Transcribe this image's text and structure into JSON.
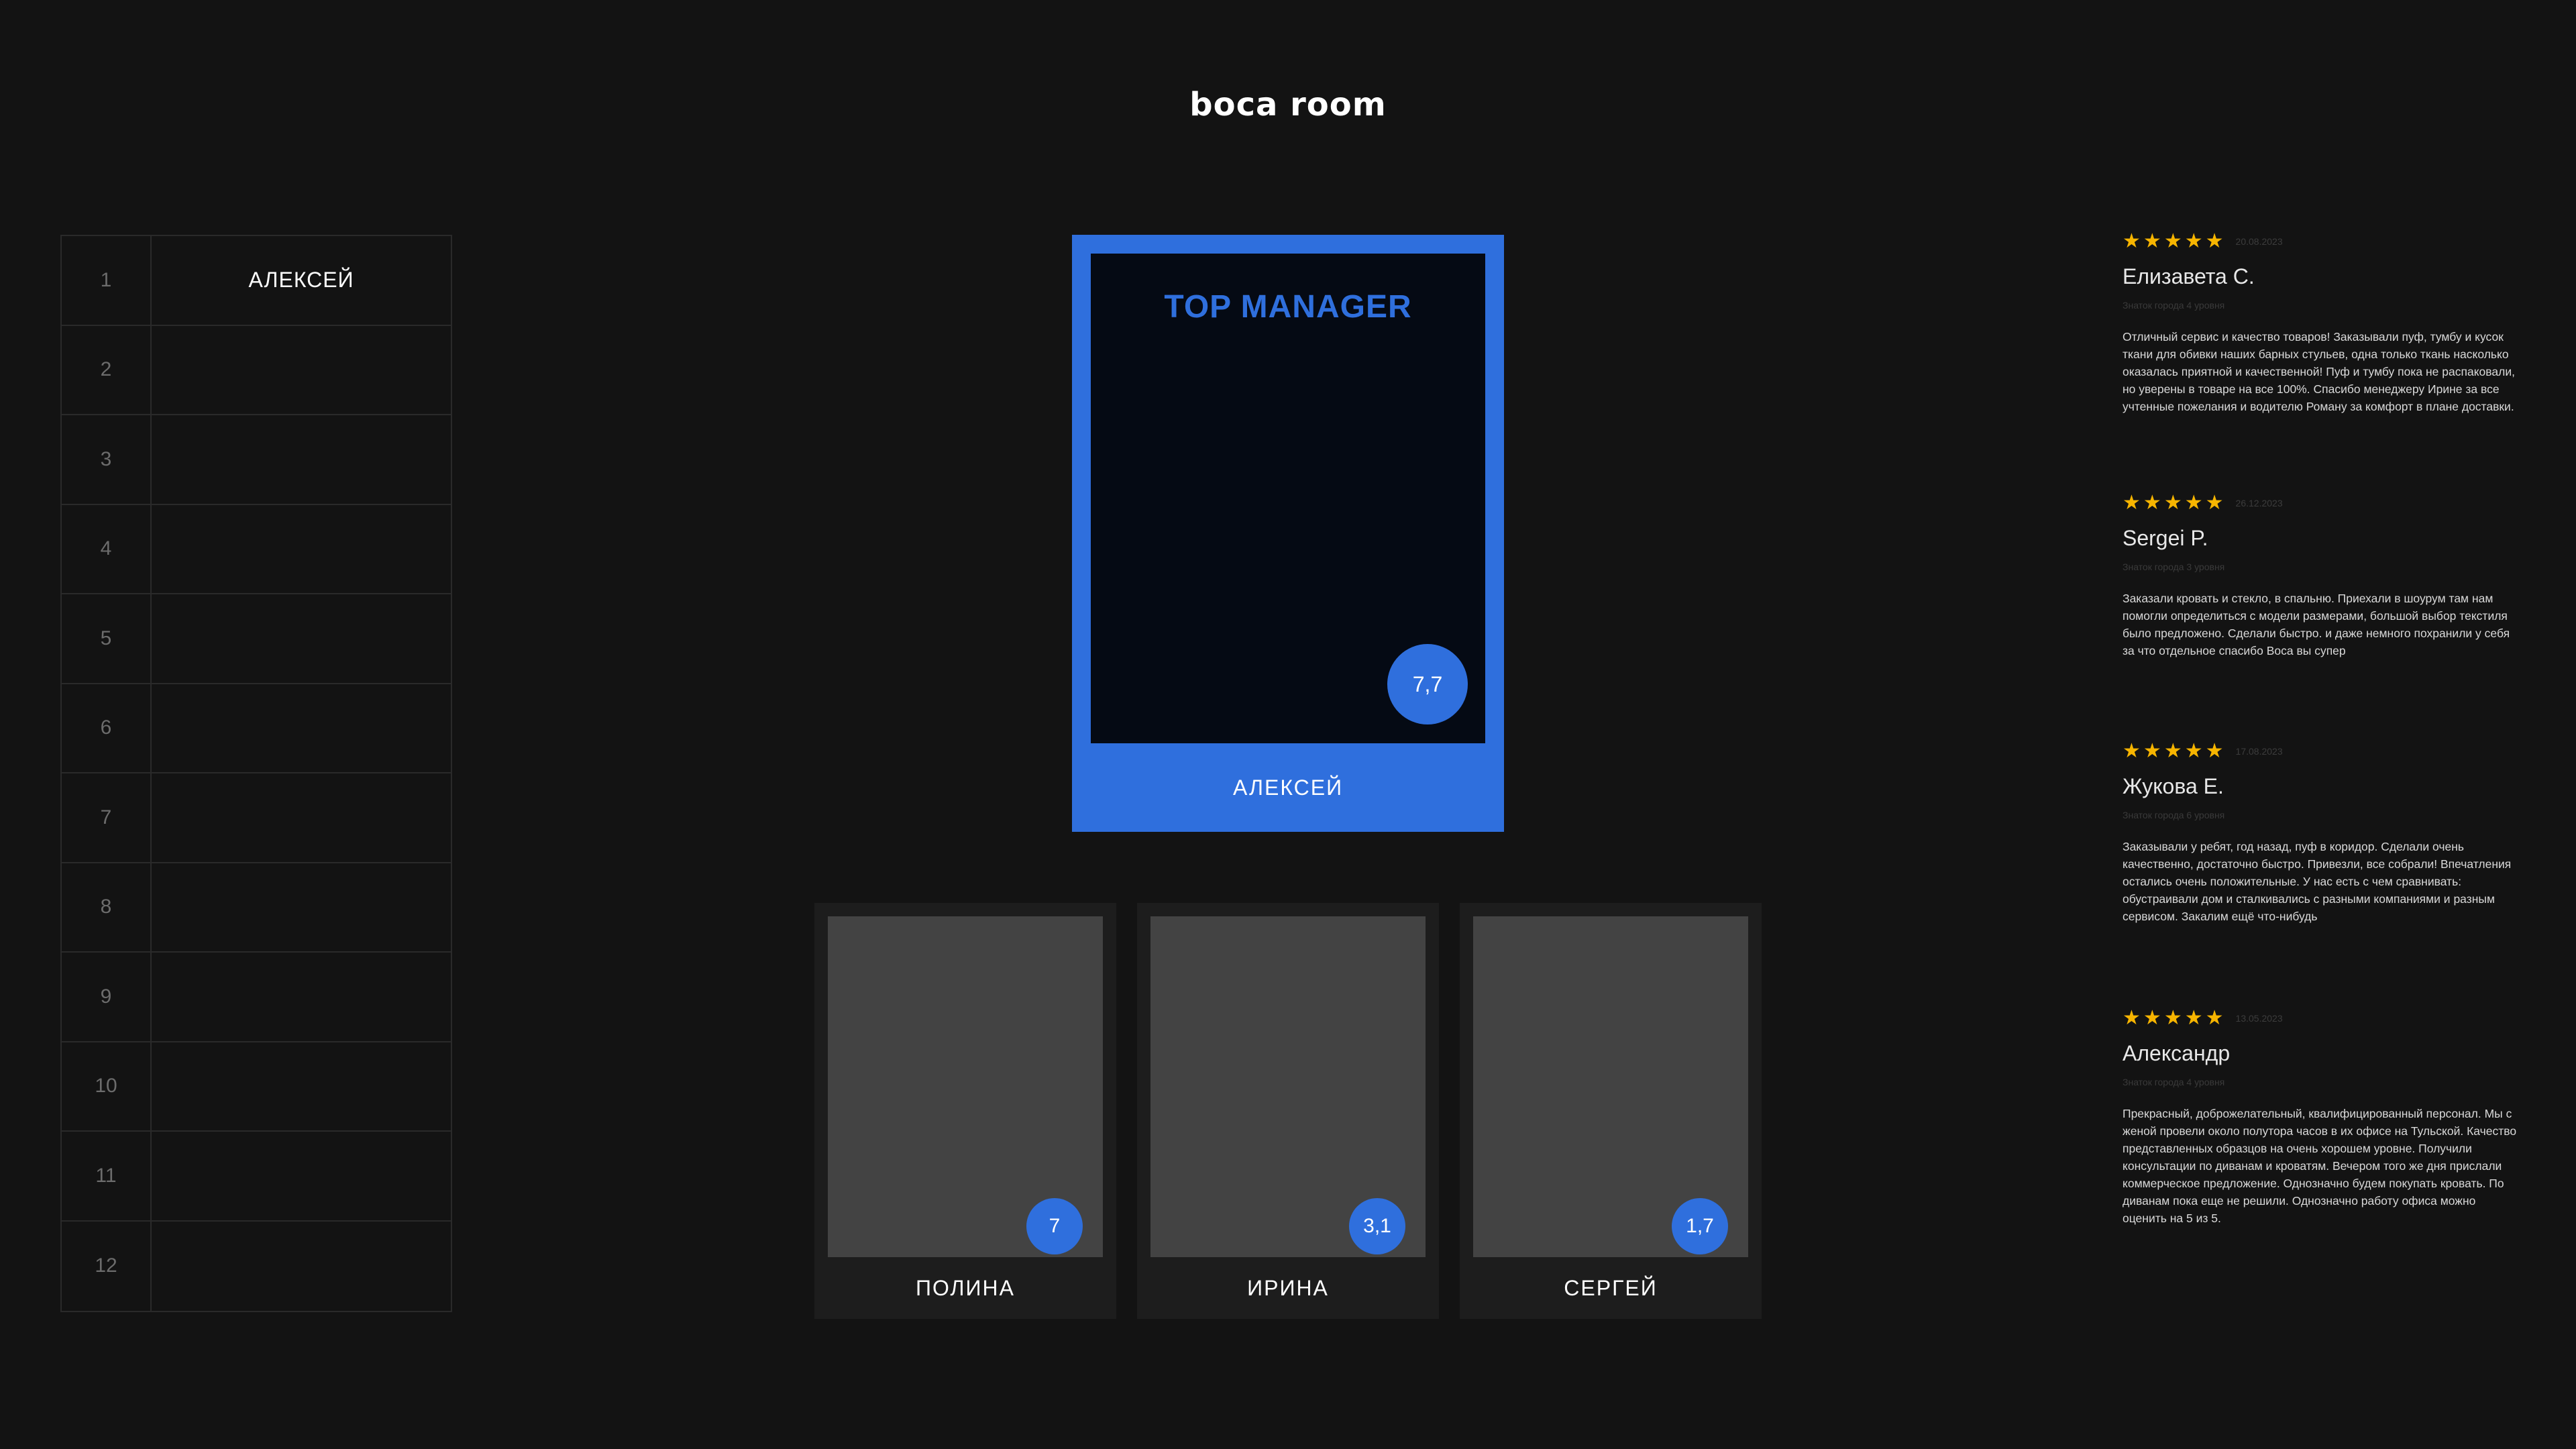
{
  "brand": {
    "logo_text": "boca room"
  },
  "leaderboard": {
    "rows": [
      {
        "rank": "1",
        "name": "АЛЕКСЕЙ"
      },
      {
        "rank": "2",
        "name": ""
      },
      {
        "rank": "3",
        "name": ""
      },
      {
        "rank": "4",
        "name": ""
      },
      {
        "rank": "5",
        "name": ""
      },
      {
        "rank": "6",
        "name": ""
      },
      {
        "rank": "7",
        "name": ""
      },
      {
        "rank": "8",
        "name": ""
      },
      {
        "rank": "9",
        "name": ""
      },
      {
        "rank": "10",
        "name": ""
      },
      {
        "rank": "11",
        "name": ""
      },
      {
        "rank": "12",
        "name": ""
      }
    ]
  },
  "top_manager": {
    "title": "TOP MANAGER",
    "score": "7,7",
    "name": "АЛЕКСЕЙ"
  },
  "managers": [
    {
      "name": "ПОЛИНА",
      "score": "7"
    },
    {
      "name": "ИРИНА",
      "score": "3,1"
    },
    {
      "name": "СЕРГЕЙ",
      "score": "1,7"
    }
  ],
  "reviews": [
    {
      "rating": 5,
      "date": "20.08.2023",
      "author": "Елизавета С.",
      "level": "Знаток города 4 уровня",
      "text": "Отличный сервис и качество товаров! Заказывали пуф, тумбу и кусок ткани для обивки наших барных стульев, одна только ткань насколько оказалась приятной и качественной! Пуф и тумбу пока не распаковали, но уверены в товаре на все 100%. Спасибо менеджеру Ирине за все учтенные пожелания и водителю Роману за комфорт в плане доставки."
    },
    {
      "rating": 5,
      "date": "26.12.2023",
      "author": "Sergei P.",
      "level": "Знаток города 3 уровня",
      "text": "Заказали кровать и стекло, в спальню. Приехали в шоурум там нам помогли определиться с модели размерами, большой выбор текстиля было предложено. Сделали быстро. и даже немного похранили у себя за что отдельное спасибо Boca вы супер"
    },
    {
      "rating": 5,
      "date": "17.08.2023",
      "author": "Жукова Е.",
      "level": "Знаток города 6 уровня",
      "text": "Заказывали у ребят, год назад, пуф в коридор. Сделали очень качественно, достаточно быстро. Привезли, все собрали! Впечатления остались очень положительные. У нас есть с чем сравнивать: обустраивали дом и сталкивались с разными компаниями и разным сервисом. Закалим ещё что-нибудь"
    },
    {
      "rating": 5,
      "date": "13.05.2023",
      "author": "Александр",
      "level": "Знаток города 4 уровня",
      "text": "Прекрасный, доброжелательный, квалифицированный персонал. Мы с женой провели около полутора часов в их офисе на Тульской. Качество представленных образцов на очень хорошем уровне. Получили консультации по диванам и кроватям. Вечером того же дня прислали коммерческое предложение. Однозначно будем покупать кровать. По диванам пока еще не решили. Однозначно работу офиса можно оценить на 5 из 5."
    }
  ],
  "colors": {
    "background": "#131313",
    "accent": "#2f6fdd",
    "star": "#f7b500"
  }
}
